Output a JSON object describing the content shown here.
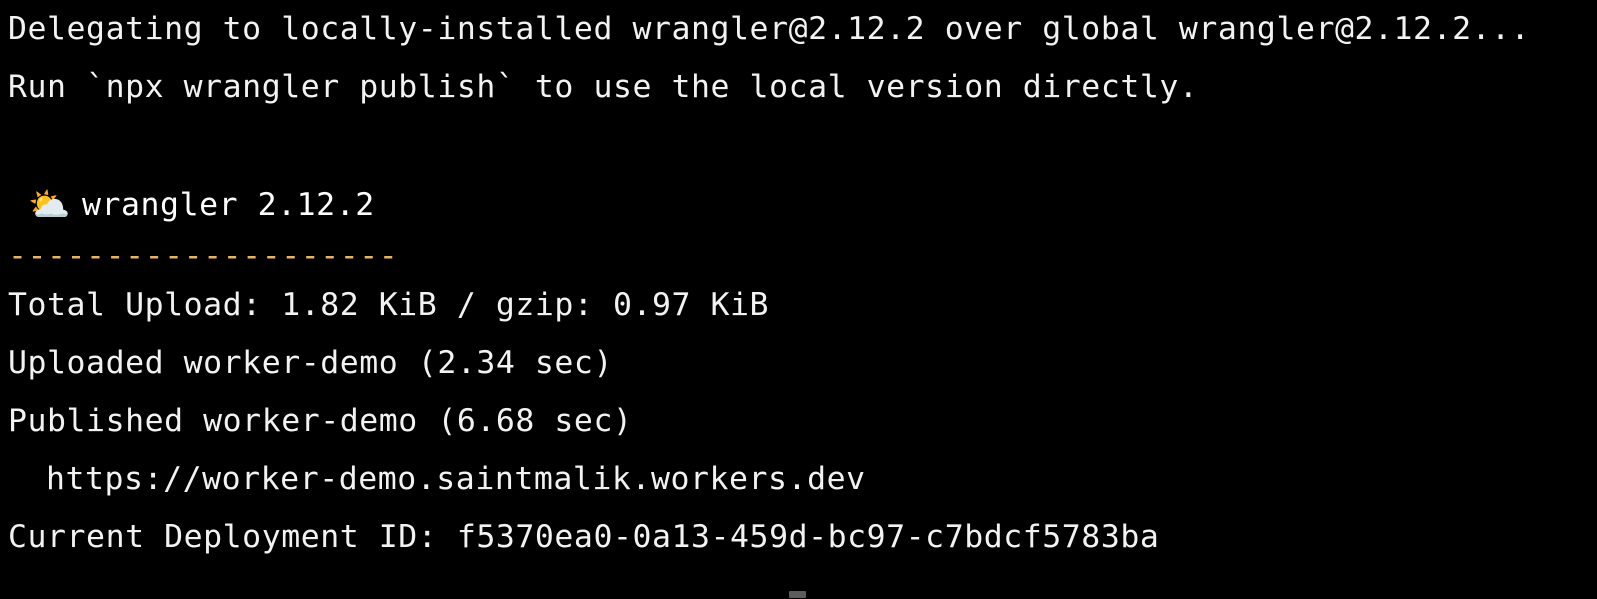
{
  "terminal": {
    "background_color": "#000000",
    "text_color": "#f2f2f2",
    "accent_color": "#e8b461",
    "lines": {
      "delegating": "Delegating to locally-installed wrangler@2.12.2 over global wrangler@2.12.2...",
      "run_hint": "Run `npx wrangler publish` to use the local version directly.",
      "blank_1": "",
      "brand_emoji": "⛅",
      "brand_text": "wrangler 2.12.2",
      "divider": "--------------------",
      "total_upload": "Total Upload: 1.82 KiB / gzip: 0.97 KiB",
      "uploaded": "Uploaded worker-demo (2.34 sec)",
      "published": "Published worker-demo (6.68 sec)",
      "deployed_url": "https://worker-demo.saintmalik.workers.dev",
      "deployment_id": "Current Deployment ID: f5370ea0-0a13-459d-bc97-c7bdcf5783ba"
    }
  },
  "scrollbar": {
    "thumb_color": "#5c5c5c",
    "orientation": "horizontal"
  }
}
